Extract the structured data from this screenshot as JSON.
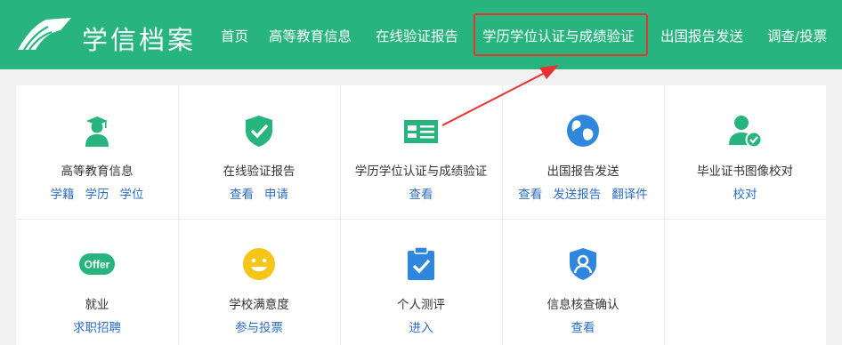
{
  "header": {
    "brand": "学信档案",
    "nav": [
      {
        "label": "首页"
      },
      {
        "label": "高等教育信息"
      },
      {
        "label": "在线验证报告"
      },
      {
        "label": "学历学位认证与成绩验证"
      },
      {
        "label": "出国报告发送"
      },
      {
        "label": "调查/投票"
      }
    ]
  },
  "cards": [
    {
      "title": "高等教育信息",
      "links": [
        "学籍",
        "学历",
        "学位"
      ],
      "icon": "graduate-icon",
      "color": "#27b47f"
    },
    {
      "title": "在线验证报告",
      "links": [
        "查看",
        "申请"
      ],
      "icon": "shield-check-icon",
      "color": "#27b47f"
    },
    {
      "title": "学历学位认证与成绩验证",
      "links": [
        "查看"
      ],
      "icon": "id-card-icon",
      "color": "#27b47f"
    },
    {
      "title": "出国报告发送",
      "links": [
        "查看",
        "发送报告",
        "翻译件"
      ],
      "icon": "globe-icon",
      "color": "#2f86dd"
    },
    {
      "title": "毕业证书图像校对",
      "links": [
        "校对"
      ],
      "icon": "user-check-icon",
      "color": "#27b47f"
    },
    {
      "title": "就业",
      "links": [
        "求职招聘"
      ],
      "icon": "offer-icon",
      "icon_text": "Offer",
      "color": "#27b47f"
    },
    {
      "title": "学校满意度",
      "links": [
        "参与投票"
      ],
      "icon": "smiley-icon",
      "color": "#f5c518"
    },
    {
      "title": "个人测评",
      "links": [
        "进入"
      ],
      "icon": "clipboard-check-icon",
      "color": "#2f86dd"
    },
    {
      "title": "信息核查确认",
      "links": [
        "查看"
      ],
      "icon": "user-shield-icon",
      "color": "#2f86dd"
    }
  ],
  "colors": {
    "brand": "#27b47f",
    "link": "#2f6fc0",
    "highlight": "#e8322e"
  }
}
